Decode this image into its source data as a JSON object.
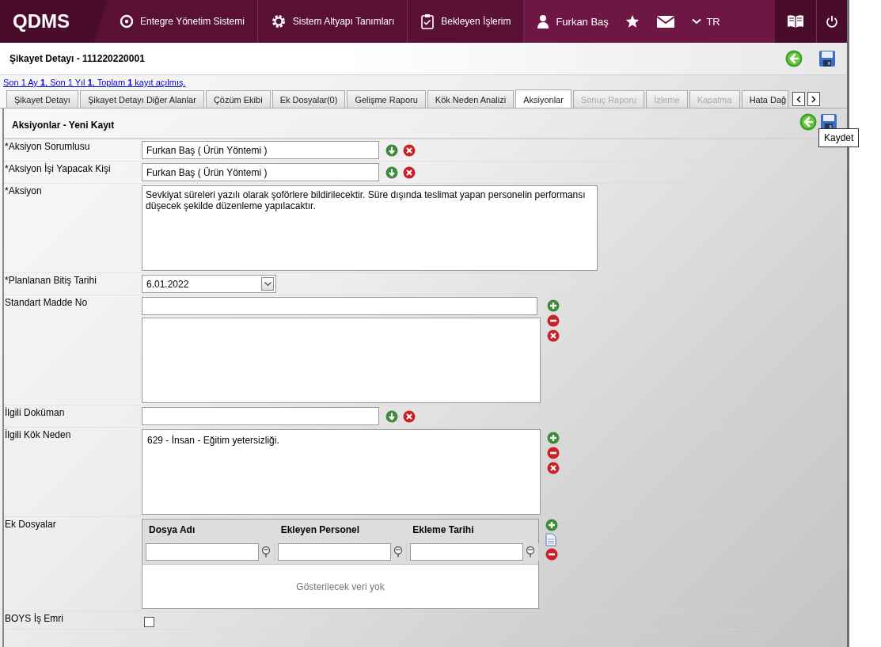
{
  "header": {
    "logo": "QDMS",
    "nav": [
      {
        "label": "Entegre Yönetim Sistemi"
      },
      {
        "label": "Sistem Altyapı Tanımları"
      },
      {
        "label": "Bekleyen İşlerim"
      }
    ],
    "user": "Furkan Baş",
    "language": "TR"
  },
  "page": {
    "title": "Şikayet Detayı - 111220220001"
  },
  "record_info": "Son 1 Ay **1**, Son 1 Yıl **1**, Toplam **1** kayıt açılmış.",
  "tabs": [
    {
      "label": "Şikayet Detayı",
      "selected": false,
      "disabled": false
    },
    {
      "label": "Şikayet Detayı Diğer Alanlar",
      "selected": false,
      "disabled": false
    },
    {
      "label": "Çözüm Ekibi",
      "selected": false,
      "disabled": false
    },
    {
      "label": "Ek Dosyalar(0)",
      "selected": false,
      "disabled": false
    },
    {
      "label": "Gelişme Raporu",
      "selected": false,
      "disabled": false
    },
    {
      "label": "Kök Neden Analizi",
      "selected": false,
      "disabled": false
    },
    {
      "label": "Aksiyonlar",
      "selected": true,
      "disabled": false
    },
    {
      "label": "Sonuç Raporu",
      "selected": false,
      "disabled": true
    },
    {
      "label": "İzleme",
      "selected": false,
      "disabled": true
    },
    {
      "label": "Kapatma",
      "selected": false,
      "disabled": true
    },
    {
      "label": "Hata Dağ",
      "selected": false,
      "disabled": false
    }
  ],
  "panel": {
    "title": "Aksiyonlar - Yeni Kayıt",
    "tooltip": "Kaydet"
  },
  "form": [
    {
      "kind": "lookup",
      "label": "*Aksiyon Sorumlusu",
      "value": "Furkan Baş ( Ürün Yöntemi )"
    },
    {
      "kind": "lookup",
      "label": "*Aksiyon İşi Yapacak Kişi",
      "value": "Furkan Baş ( Ürün Yöntemi )"
    },
    {
      "kind": "textarea",
      "label": "*Aksiyon",
      "value": "Sevkiyat süreleri yazılı olarak şoförlere bildirilecektir. Süre dışında teslimat yapan personelin performansı düşecek şekilde düzenleme yapılacaktır."
    },
    {
      "kind": "date",
      "label": "*Planlanan Bitiş Tarihi",
      "value": "6.01.2022"
    },
    {
      "kind": "multi",
      "label": "Standart Madde No"
    },
    {
      "kind": "lookup",
      "label": "İlgili Doküman"
    },
    {
      "kind": "list",
      "label": "İlgili Kök Neden",
      "value": "629 - İnsan - Eğitim yetersizliği."
    },
    {
      "kind": "grid",
      "label": "Ek Dosyalar",
      "columns": [
        "Dosya Adı",
        "Ekleyen Personel",
        "Ekleme Tarihi"
      ],
      "empty_text": "Gösterilecek veri yok"
    },
    {
      "kind": "checkbox",
      "label": "BOYS İş Emri",
      "checked": false
    }
  ]
}
